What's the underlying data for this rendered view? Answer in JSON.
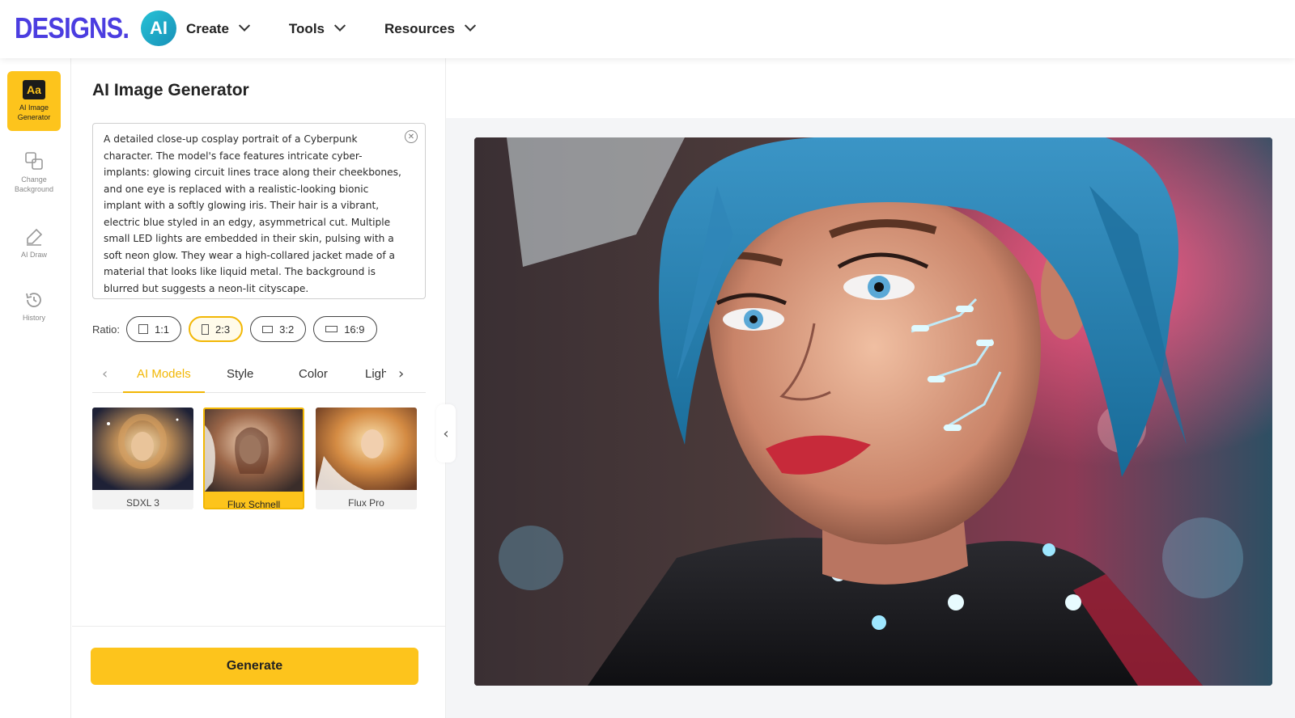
{
  "header": {
    "logo_text": "DESIGNS.",
    "logo_badge": "AI",
    "nav": [
      {
        "label": "Create"
      },
      {
        "label": "Tools"
      },
      {
        "label": "Resources"
      }
    ]
  },
  "rail": {
    "items": [
      {
        "label": "AI Image Generator",
        "icon": "aa-icon",
        "active": true,
        "glyph": "Aa"
      },
      {
        "label": "Change Background",
        "icon": "change-background-icon",
        "active": false
      },
      {
        "label": "AI Draw",
        "icon": "pen-icon",
        "active": false
      },
      {
        "label": "History",
        "icon": "history-icon",
        "active": false
      }
    ]
  },
  "panel": {
    "title": "AI Image Generator",
    "prompt": "A detailed close-up cosplay portrait of a Cyberpunk character. The model's face features intricate cyber-implants: glowing circuit lines trace along their cheekbones, and one eye is replaced with a realistic-looking bionic implant with a softly glowing iris. Their hair is a vibrant, electric blue styled in an edgy, asymmetrical cut. Multiple small LED lights are embedded in their skin, pulsing with a soft neon glow. They wear a high-collared jacket made of a material that looks like liquid metal. The background is blurred but suggests a neon-lit cityscape.",
    "ratio_label": "Ratio:",
    "ratios": [
      {
        "label": "1:1",
        "selected": false
      },
      {
        "label": "2:3",
        "selected": true
      },
      {
        "label": "3:2",
        "selected": false
      },
      {
        "label": "16:9",
        "selected": false
      }
    ],
    "tabs": [
      {
        "label": "AI Models",
        "active": true
      },
      {
        "label": "Style",
        "active": false
      },
      {
        "label": "Color",
        "active": false
      },
      {
        "label": "Ligh",
        "active": false
      }
    ],
    "models": [
      {
        "name": "SDXL 3",
        "selected": false
      },
      {
        "name": "Flux Schnell",
        "selected": true
      },
      {
        "name": "Flux Pro",
        "selected": false
      }
    ],
    "generate_label": "Generate"
  },
  "colors": {
    "accent": "#fdc41c",
    "accent_dark": "#f2b705",
    "logo_purple": "#4b3de0",
    "logo_teal": "#1fa9c9"
  }
}
